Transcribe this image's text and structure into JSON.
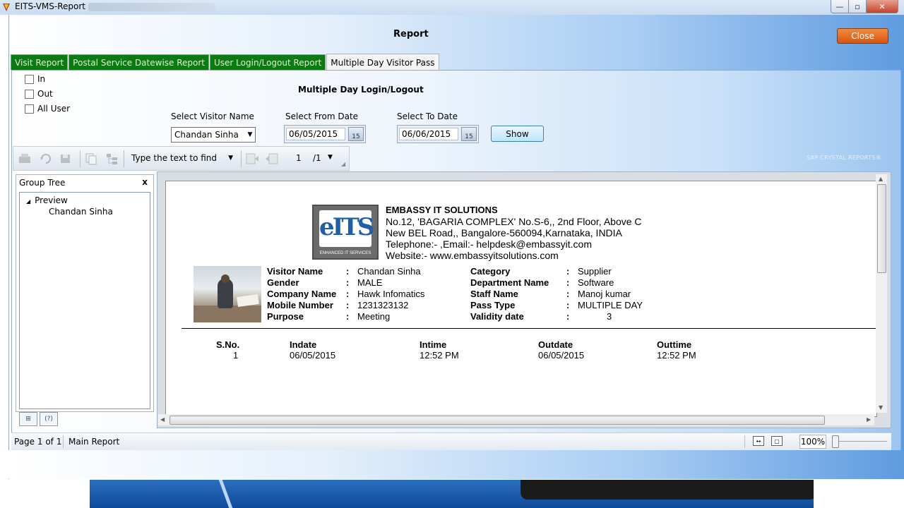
{
  "window": {
    "title": "EITS-VMS-Report",
    "min_icon": "minimize-icon",
    "max_icon": "maximize-icon",
    "close_glyph": "✕"
  },
  "header": {
    "title": "Report",
    "close_label": "Close"
  },
  "tabs": [
    {
      "label": "Visit Report"
    },
    {
      "label": "Postal Service Datewise Report"
    },
    {
      "label": "User Login/Logout Report"
    },
    {
      "label": "Multiple Day Visitor Pass",
      "active": true
    }
  ],
  "filters": {
    "checkbox_in": "In",
    "checkbox_out": "Out",
    "checkbox_all": "All User",
    "section_title": "Multiple Day Login/Logout",
    "visitor_label": "Select Visitor Name",
    "visitor_value": "Chandan Sinha",
    "from_label": "Select From Date",
    "from_value": "06/05/2015",
    "to_label": "Select To Date",
    "to_value": "06/06/2015",
    "calendar_day": "15",
    "show_label": "Show"
  },
  "toolbar": {
    "find_placeholder": "Type the text to find",
    "page_current": "1",
    "page_total": "/1",
    "brand": "SAP CRYSTAL REPORTS®"
  },
  "group_tree": {
    "title": "Group Tree",
    "close": "x",
    "root": "Preview",
    "child": "Chandan Sinha",
    "help_glyph": "(?)"
  },
  "report": {
    "company": "EMBASSY IT SOLUTIONS",
    "address1": "No.12, 'BAGARIA COMPLEX' No.S-6,, 2nd Floor, Above C",
    "address2": "New BEL Road,, Bangalore-560094,Karnataka, INDIA",
    "telephone": "Telephone:- ,Email:- helpdesk@embassyit.com",
    "website": "Website:- www.embassyitsolutions.com",
    "logo_text": "eITS",
    "logo_sub": "ENHANCED IT SERVICES",
    "colon": ":",
    "fields_left": [
      {
        "label": "Visitor Name",
        "value": "Chandan Sinha"
      },
      {
        "label": "Gender",
        "value": "MALE"
      },
      {
        "label": "Company Name",
        "value": "Hawk Infomatics"
      },
      {
        "label": "Mobile Number",
        "value": "1231323132"
      },
      {
        "label": "Purpose",
        "value": "Meeting"
      }
    ],
    "fields_right": [
      {
        "label": "Category",
        "value": "Supplier"
      },
      {
        "label": "Department Name",
        "value": "Software"
      },
      {
        "label": "Staff Name",
        "value": "Manoj kumar"
      },
      {
        "label": "Pass Type",
        "value": "MULTIPLE DAY"
      },
      {
        "label": "Validity date",
        "value": "3"
      }
    ],
    "table": {
      "headers": [
        "S.No.",
        "Indate",
        "Intime",
        "Outdate",
        "Outtime"
      ],
      "row": [
        "1",
        "06/05/2015",
        "12:52 PM",
        "06/05/2015",
        "12:52 PM"
      ]
    }
  },
  "status": {
    "page": "Page 1 of 1",
    "report": "Main Report",
    "zoom": "100%"
  }
}
